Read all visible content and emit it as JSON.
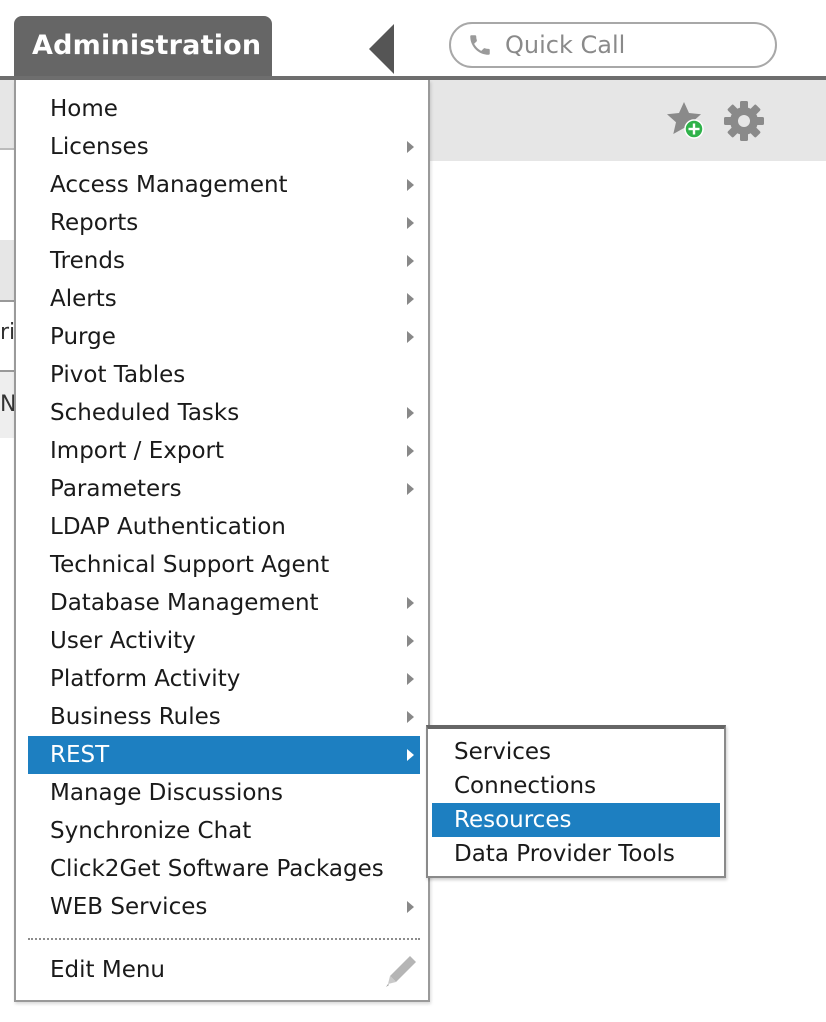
{
  "header": {
    "title": "Administration",
    "quick_call_placeholder": "Quick Call"
  },
  "background": {
    "fragment_1": "ri",
    "fragment_2": "Nu"
  },
  "menu": {
    "items": [
      {
        "label": "Home",
        "submenu": false
      },
      {
        "label": "Licenses",
        "submenu": true
      },
      {
        "label": "Access Management",
        "submenu": true
      },
      {
        "label": "Reports",
        "submenu": true
      },
      {
        "label": "Trends",
        "submenu": true
      },
      {
        "label": "Alerts",
        "submenu": true
      },
      {
        "label": "Purge",
        "submenu": true
      },
      {
        "label": "Pivot Tables",
        "submenu": false
      },
      {
        "label": "Scheduled Tasks",
        "submenu": true
      },
      {
        "label": "Import / Export",
        "submenu": true
      },
      {
        "label": "Parameters",
        "submenu": true
      },
      {
        "label": "LDAP Authentication",
        "submenu": false
      },
      {
        "label": "Technical Support Agent",
        "submenu": false
      },
      {
        "label": "Database Management",
        "submenu": true
      },
      {
        "label": "User Activity",
        "submenu": true
      },
      {
        "label": "Platform Activity",
        "submenu": true
      },
      {
        "label": "Business Rules",
        "submenu": true
      },
      {
        "label": "REST",
        "submenu": true,
        "active": true
      },
      {
        "label": "Manage Discussions",
        "submenu": false
      },
      {
        "label": "Synchronize Chat",
        "submenu": false
      },
      {
        "label": "Click2Get Software Packages",
        "submenu": false
      },
      {
        "label": "WEB Services",
        "submenu": true
      }
    ],
    "edit_label": "Edit Menu"
  },
  "rest_submenu": {
    "items": [
      {
        "label": "Services"
      },
      {
        "label": "Connections"
      },
      {
        "label": "Resources",
        "active": true
      },
      {
        "label": "Data Provider Tools"
      }
    ]
  },
  "icons": {
    "phone": "phone-icon",
    "favorite": "star-plus-icon",
    "settings": "gear-icon",
    "edit": "pencil-icon",
    "collapse": "caret-left-icon"
  },
  "colors": {
    "accent": "#1d7fc1",
    "header_tab": "#666666",
    "fav_plus": "#2fb24a"
  }
}
